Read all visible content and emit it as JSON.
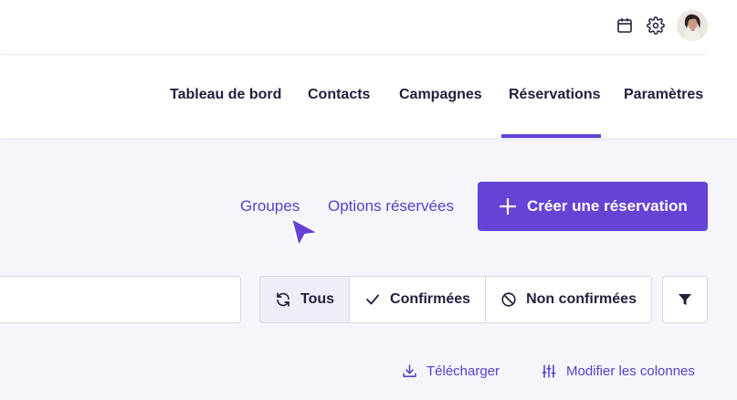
{
  "header": {
    "icons": [
      "calendar-icon",
      "gear-icon",
      "avatar"
    ]
  },
  "nav": {
    "items": [
      {
        "label": "Tableau de bord",
        "active": false
      },
      {
        "label": "Contacts",
        "active": false
      },
      {
        "label": "Campagnes",
        "active": false
      },
      {
        "label": "Réservations",
        "active": true
      },
      {
        "label": "Paramètres",
        "active": false
      }
    ],
    "accent": "#6443d5"
  },
  "actions": {
    "groups_link": "Groupes",
    "options_link": "Options réservées",
    "create_button": "Créer une réservation"
  },
  "search": {
    "value": "",
    "placeholder": ""
  },
  "status_filter": {
    "options": [
      {
        "label": "Tous",
        "icon": "refresh-icon",
        "active": true
      },
      {
        "label": "Confirmées",
        "icon": "check-icon",
        "active": false
      },
      {
        "label": "Non confirmées",
        "icon": "ban-icon",
        "active": false
      }
    ],
    "filter_icon": "filter-icon"
  },
  "toolbar": {
    "download": "Télécharger",
    "modify_columns": "Modifier les colonnes"
  },
  "colors": {
    "primary": "#6443d5",
    "link": "#5a3fc9",
    "text": "#221f3b",
    "background": "#f5f5fb"
  }
}
